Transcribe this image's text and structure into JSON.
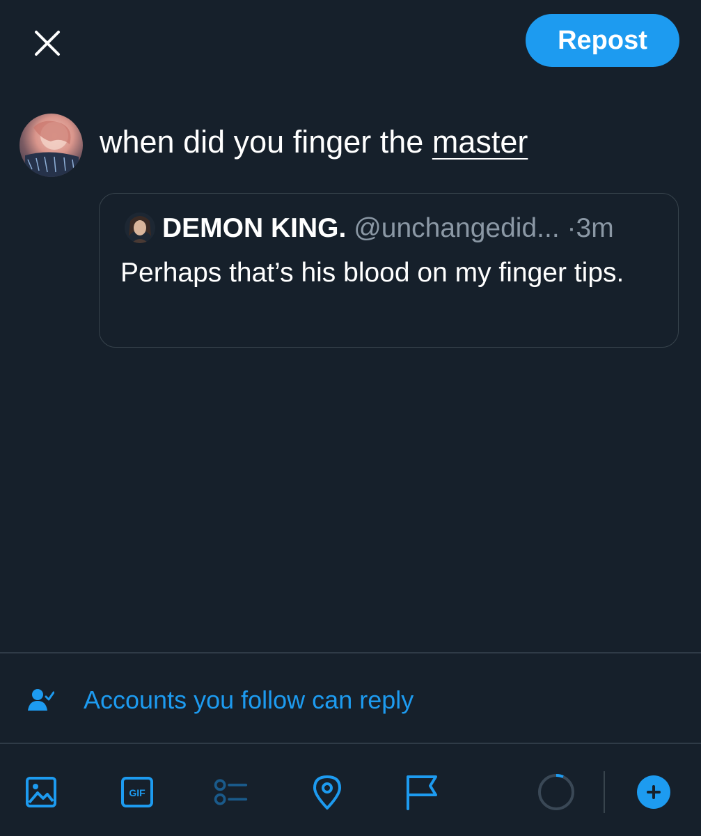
{
  "header": {
    "close_icon": "close-icon",
    "repost_label": "Repost"
  },
  "compose": {
    "text_before": "when did you finger the ",
    "text_link": "master"
  },
  "quoted_post": {
    "display_name": "DEMON KING.",
    "handle": "@unchangedid...",
    "separator": "·",
    "time": "3m",
    "body": "Perhaps that’s his blood on my finger tips."
  },
  "reply_setting": {
    "icon": "person-check-icon",
    "label": "Accounts you follow can reply"
  },
  "toolbar": {
    "icons": [
      "image-icon",
      "gif-icon",
      "poll-icon",
      "location-icon",
      "flag-icon",
      "character-count-ring-icon",
      "add-thread-icon"
    ]
  },
  "colors": {
    "background": "#16202b",
    "accent": "#1d9bf0",
    "border": "#38444d",
    "muted_text": "#8b98a5"
  }
}
